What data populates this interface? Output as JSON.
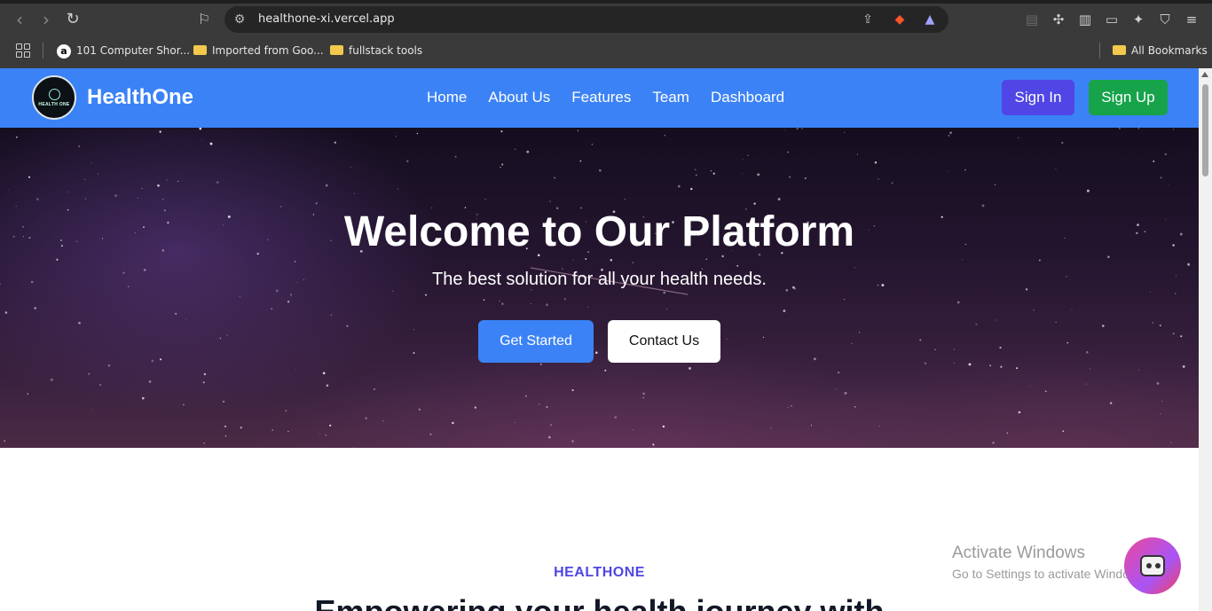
{
  "browser": {
    "url": "healthone-xi.vercel.app",
    "bookmarks": [
      {
        "label": "101 Computer Shor...",
        "icon": "avatar-a-icon"
      },
      {
        "label": "Imported from Goo...",
        "icon": "folder-icon"
      },
      {
        "label": "fullstack tools",
        "icon": "folder-icon"
      }
    ],
    "all_bookmarks": "All Bookmarks"
  },
  "site": {
    "brand": "HealthOne",
    "logo_text": "HEALTH ONE",
    "nav": [
      "Home",
      "About Us",
      "Features",
      "Team",
      "Dashboard"
    ],
    "sign_in": "Sign In",
    "sign_up": "Sign Up",
    "colors": {
      "nav_bg": "#3b82f6",
      "sign_in_bg": "#4f46e5",
      "sign_up_bg": "#16a34a"
    }
  },
  "hero": {
    "title": "Welcome to Our Platform",
    "subtitle": "The best solution for all your health needs.",
    "primary_cta": "Get Started",
    "secondary_cta": "Contact Us"
  },
  "section": {
    "label": "HEALTHONE",
    "title": "Empowering your health journey with"
  },
  "overlay": {
    "watermark_line1": "Activate Windows",
    "watermark_line2": "Go to Settings to activate Windows."
  }
}
